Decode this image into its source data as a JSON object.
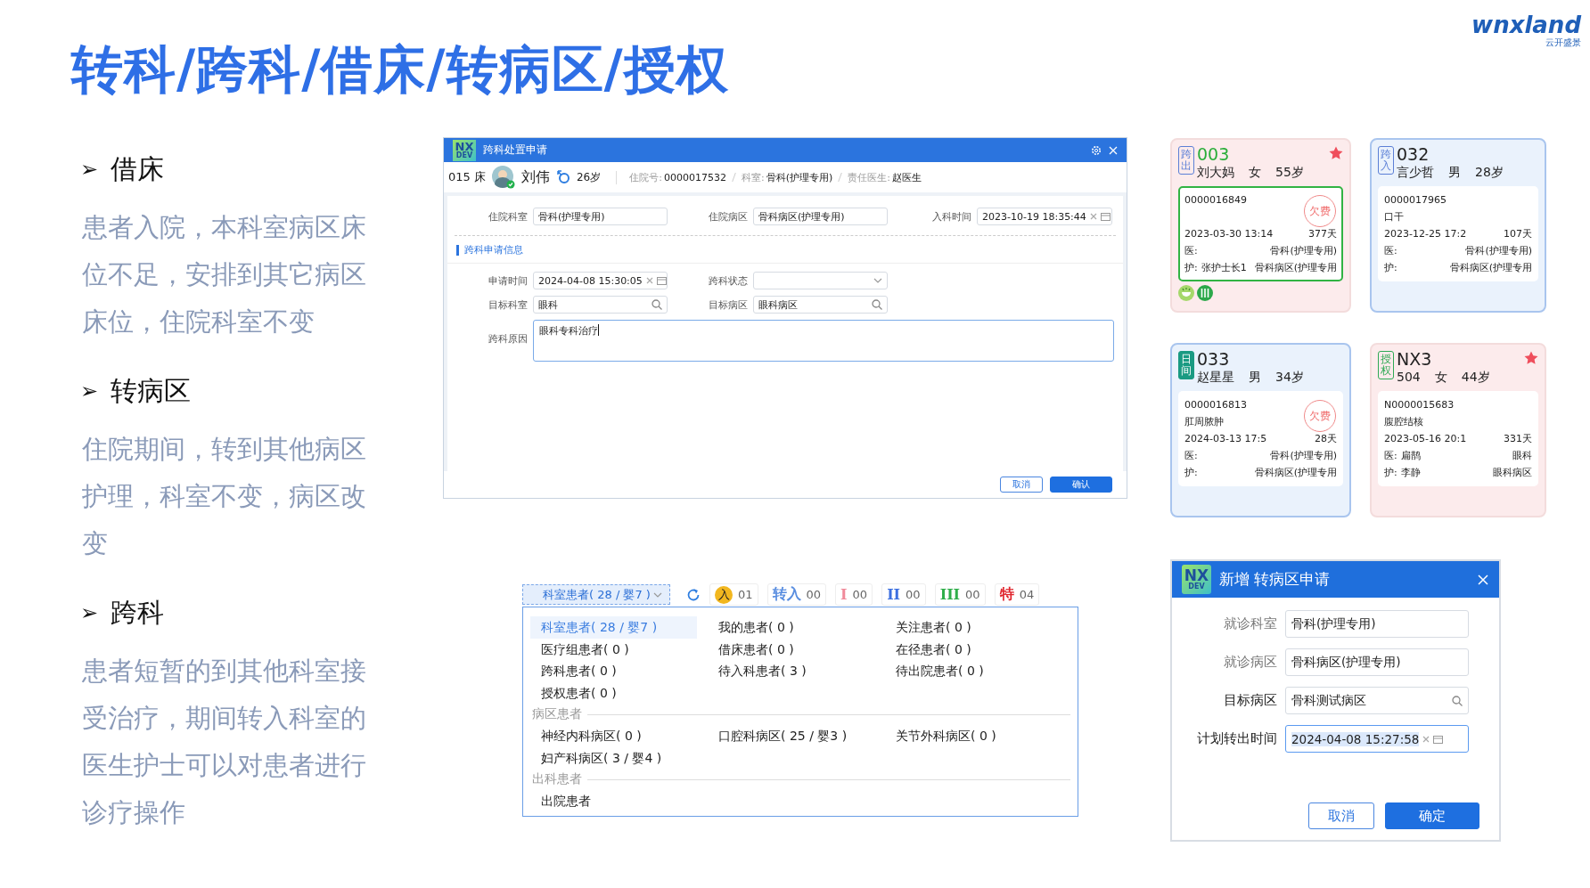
{
  "slide": {
    "title": "转科/跨科/借床/转病区/授权",
    "logo": {
      "name": "wnxland",
      "tagline": "云开盛景"
    }
  },
  "sections": [
    {
      "marker": "➢",
      "heading": "借床",
      "text": "患者入院，本科室病区床位不足，安排到其它病区床位，住院科室不变"
    },
    {
      "marker": "➢",
      "heading": "转病区",
      "text": "住院期间，转到其他病区护理，科室不变，病区改变"
    },
    {
      "marker": "➢",
      "heading": "跨科",
      "text": "患者短暂的到其他科室接受治疗，期间转入科室的医生护士可以对患者进行诊疗操作"
    }
  ],
  "transfer_dialog": {
    "logo": "NX",
    "logo_sub": "DEV",
    "title": "跨科处置申请",
    "patient": {
      "bed": "015 床",
      "name": "刘伟",
      "age": "26岁",
      "fields": [
        {
          "label": "住院号:",
          "value": "0000017532"
        },
        {
          "label": "科室:",
          "value": "骨科(护理专用)"
        },
        {
          "label": "责任医生:",
          "value": "赵医生"
        }
      ]
    },
    "info_fields": [
      {
        "label": "住院科室",
        "value": "骨科(护理专用)",
        "kind": "text"
      },
      {
        "label": "住院病区",
        "value": "骨科病区(护理专用)",
        "kind": "text"
      },
      {
        "label": "入科时间",
        "value": "2023-10-19 18:35:44",
        "kind": "date"
      }
    ],
    "section_title": "跨科申请信息",
    "form_fields": [
      {
        "label": "申请时间",
        "value": "2024-04-08 15:30:05",
        "kind": "date"
      },
      {
        "label": "跨科状态",
        "kind": "select"
      },
      {
        "label": "目标科室",
        "value": "眼科",
        "kind": "search"
      },
      {
        "label": "目标病区",
        "value": "眼科病区",
        "kind": "search"
      }
    ],
    "reason": {
      "label": "跨科原因",
      "value": "眼科专科治疗"
    },
    "buttons": [
      {
        "label": "取消",
        "kind": "secondary"
      },
      {
        "label": "确认",
        "kind": "primary"
      }
    ]
  },
  "cards": [
    {
      "color": "#fcebec",
      "selected": true,
      "starred": true,
      "tag": {
        "text": "跨出",
        "color": "#5b7fd6",
        "filled": false
      },
      "bed": "003",
      "name": "刘大妈",
      "sex": "女",
      "age": "55岁",
      "id": "0000016849",
      "stamp": "欠费",
      "date": "2023-03-30 13:14",
      "days": "377天",
      "doctor": {
        "label": "医:",
        "dept": "骨科(护理专用)"
      },
      "nurse": {
        "label": "护:",
        "name": "张护士长1",
        "ward": "骨科病区(护理专用"
      },
      "badges": [
        {
          "kind": "smile"
        },
        {
          "kind": "level3"
        }
      ]
    },
    {
      "color": "#eaf2fc",
      "selected": false,
      "starred": false,
      "tag": {
        "text": "跨入",
        "color": "#5b7fd6",
        "filled": false
      },
      "bed": "032",
      "name": "言少哲",
      "sex": "男",
      "age": "28岁",
      "id": "0000017965",
      "diagnosis": "口干",
      "date": "2023-12-25 17:2",
      "days": "107天",
      "doctor": {
        "label": "医:",
        "dept": "骨科(护理专用)"
      },
      "nurse": {
        "label": "护:",
        "ward": "骨科病区(护理专用"
      }
    },
    {
      "color": "#eaf2fc",
      "selected": false,
      "starred": false,
      "tag": {
        "text": "日间",
        "color": "#1a9a82",
        "filled": true
      },
      "bed": "033",
      "name": "赵星星",
      "sex": "男",
      "age": "34岁",
      "id": "0000016813",
      "diagnosis": "肛周脓肿",
      "stamp": "欠费",
      "date": "2024-03-13 17:5",
      "days": "28天",
      "doctor": {
        "label": "医:",
        "dept": "骨科(护理专用)"
      },
      "nurse": {
        "label": "护:",
        "ward": "骨科病区(护理专用"
      }
    },
    {
      "color": "#fcebec",
      "selected": false,
      "starred": true,
      "tag": {
        "text": "授权",
        "color": "#2eaa55",
        "filled": false
      },
      "bed": "NX3",
      "name": "504",
      "sex": "女",
      "age": "44岁",
      "id": "N0000015683",
      "diagnosis": "腹腔结核",
      "date": "2023-05-16 20:1",
      "days": "331天",
      "doctor": {
        "label": "医:",
        "name": "扁鹊",
        "dept": "眼科"
      },
      "nurse": {
        "label": "护:",
        "name": "李静",
        "ward": "眼科病区"
      }
    }
  ],
  "patient_list": {
    "dropdown": "科室患者( 28 / 婴7 )",
    "counters": [
      {
        "kind": "circle",
        "label": "入",
        "count": "01",
        "color": "#f2b71f"
      },
      {
        "kind": "text",
        "label": "转入",
        "count": "00",
        "color": "#5a8ee0"
      },
      {
        "kind": "text",
        "label": "I",
        "count": "00",
        "color": "#f08a9a"
      },
      {
        "kind": "text",
        "label": "II",
        "count": "00",
        "color": "#3c6fe0"
      },
      {
        "kind": "text",
        "label": "III",
        "count": "00",
        "color": "#2fae4a"
      },
      {
        "kind": "text",
        "label": "特",
        "count": "04",
        "color": "#e0242c"
      }
    ],
    "groups": [
      {
        "items": [
          {
            "label": "科室患者( 28 / 婴7 )",
            "selected": true
          },
          {
            "label": "我的患者( 0 )",
            "selected": false
          },
          {
            "label": "关注患者( 0 )",
            "selected": false
          },
          {
            "label": "医疗组患者( 0 )",
            "selected": false
          },
          {
            "label": "借床患者( 0 )",
            "selected": false
          },
          {
            "label": "在径患者( 0 )",
            "selected": false
          },
          {
            "label": "跨科患者( 0 )",
            "selected": false
          },
          {
            "label": "待入科患者( 3 )",
            "selected": false
          },
          {
            "label": "待出院患者( 0 )",
            "selected": false
          },
          {
            "label": "授权患者( 0 )",
            "selected": false
          }
        ]
      },
      {
        "header": "病区患者",
        "items": [
          {
            "label": "神经内科病区( 0 )",
            "selected": false
          },
          {
            "label": "口腔科病区( 25 / 婴3 )",
            "selected": false
          },
          {
            "label": "关节外科病区( 0 )",
            "selected": false
          },
          {
            "label": "妇产科病区( 3 / 婴4 )",
            "selected": false
          }
        ]
      },
      {
        "header": "出科患者",
        "items": [
          {
            "label": "出院患者",
            "selected": false
          }
        ]
      }
    ]
  },
  "ward_dialog": {
    "logo": "NX",
    "logo_sub": "DEV",
    "title": "新增 转病区申请",
    "fields": [
      {
        "label": "就诊科室",
        "value": "骨科(护理专用)",
        "kind": "text",
        "disabled": true,
        "focused": false
      },
      {
        "label": "就诊病区",
        "value": "骨科病区(护理专用)",
        "kind": "text",
        "disabled": true,
        "focused": false
      },
      {
        "label": "目标病区",
        "value": "骨科测试病区",
        "kind": "search",
        "disabled": false,
        "focused": false
      },
      {
        "label": "计划转出时间",
        "value": "2024-04-08 15:27:58",
        "kind": "date",
        "disabled": false,
        "focused": true
      }
    ],
    "buttons": [
      {
        "label": "取消",
        "kind": "secondary"
      },
      {
        "label": "确定",
        "kind": "primary"
      }
    ]
  }
}
